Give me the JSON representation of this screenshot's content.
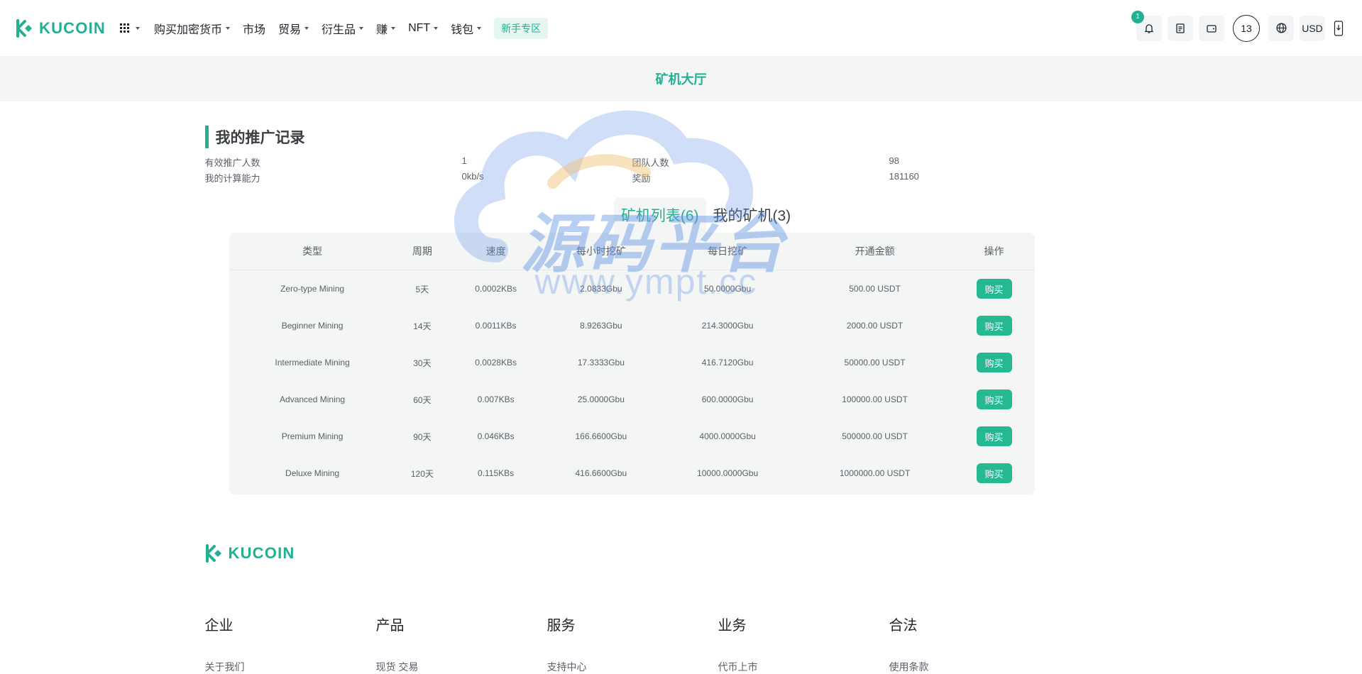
{
  "colors": {
    "accent": "#23af91",
    "button": "#26b890",
    "panel": "#f4f5f5"
  },
  "header": {
    "logo_text": "KUCOIN",
    "nav": [
      {
        "label": "购买加密货币",
        "dropdown": true
      },
      {
        "label": "市场",
        "dropdown": false
      },
      {
        "label": "贸易",
        "dropdown": true
      },
      {
        "label": "衍生品",
        "dropdown": true
      },
      {
        "label": "赚",
        "dropdown": true
      },
      {
        "label": "NFT",
        "dropdown": true
      },
      {
        "label": "钱包",
        "dropdown": true
      }
    ],
    "newbie_label": "新手专区",
    "notification_count": "1",
    "avatar_label": "13",
    "currency": "USD",
    "icons": [
      "bell-icon",
      "orders-icon",
      "wallet-icon",
      "globe-icon",
      "download-icon"
    ]
  },
  "subbar": {
    "title": "矿机大厅"
  },
  "promo": {
    "title": "我的推广记录",
    "stats": [
      {
        "label": "有效推广人数",
        "value": "1"
      },
      {
        "label": "团队人数",
        "value": "98"
      },
      {
        "label": "我的计算能力",
        "value": "0kb/s"
      },
      {
        "label": "奖励",
        "value": "181160"
      }
    ]
  },
  "tabs": [
    {
      "label": "矿机列表(6)",
      "active": true
    },
    {
      "label": "我的矿机(3)",
      "active": false
    }
  ],
  "table": {
    "headers": [
      "类型",
      "周期",
      "速度",
      "每小时挖矿",
      "每日挖矿",
      "开通金额",
      "操作"
    ],
    "buy_label": "购买",
    "rows": [
      [
        "Zero-type Mining",
        "5天",
        "0.0002KBs",
        "2.0833Gbu",
        "50.0000Gbu",
        "500.00 USDT"
      ],
      [
        "Beginner Mining",
        "14天",
        "0.0011KBs",
        "8.9263Gbu",
        "214.3000Gbu",
        "2000.00 USDT"
      ],
      [
        "Intermediate Mining",
        "30天",
        "0.0028KBs",
        "17.3333Gbu",
        "416.7120Gbu",
        "50000.00 USDT"
      ],
      [
        "Advanced Mining",
        "60天",
        "0.007KBs",
        "25.0000Gbu",
        "600.0000Gbu",
        "100000.00 USDT"
      ],
      [
        "Premium Mining",
        "90天",
        "0.046KBs",
        "166.6600Gbu",
        "4000.0000Gbu",
        "500000.00 USDT"
      ],
      [
        "Deluxe Mining",
        "120天",
        "0.115KBs",
        "416.6600Gbu",
        "10000.0000Gbu",
        "1000000.00 USDT"
      ]
    ]
  },
  "watermark": {
    "text": "源码平台",
    "url": "www.ympt.cc"
  },
  "footer": {
    "logo_text": "KUCOIN",
    "columns": [
      {
        "title": "企业",
        "link": "关于我们"
      },
      {
        "title": "产品",
        "link": "现货 交易"
      },
      {
        "title": "服务",
        "link": "支持中心"
      },
      {
        "title": "业务",
        "link": "代币上市"
      },
      {
        "title": "合法",
        "link": "使用条款"
      }
    ]
  }
}
